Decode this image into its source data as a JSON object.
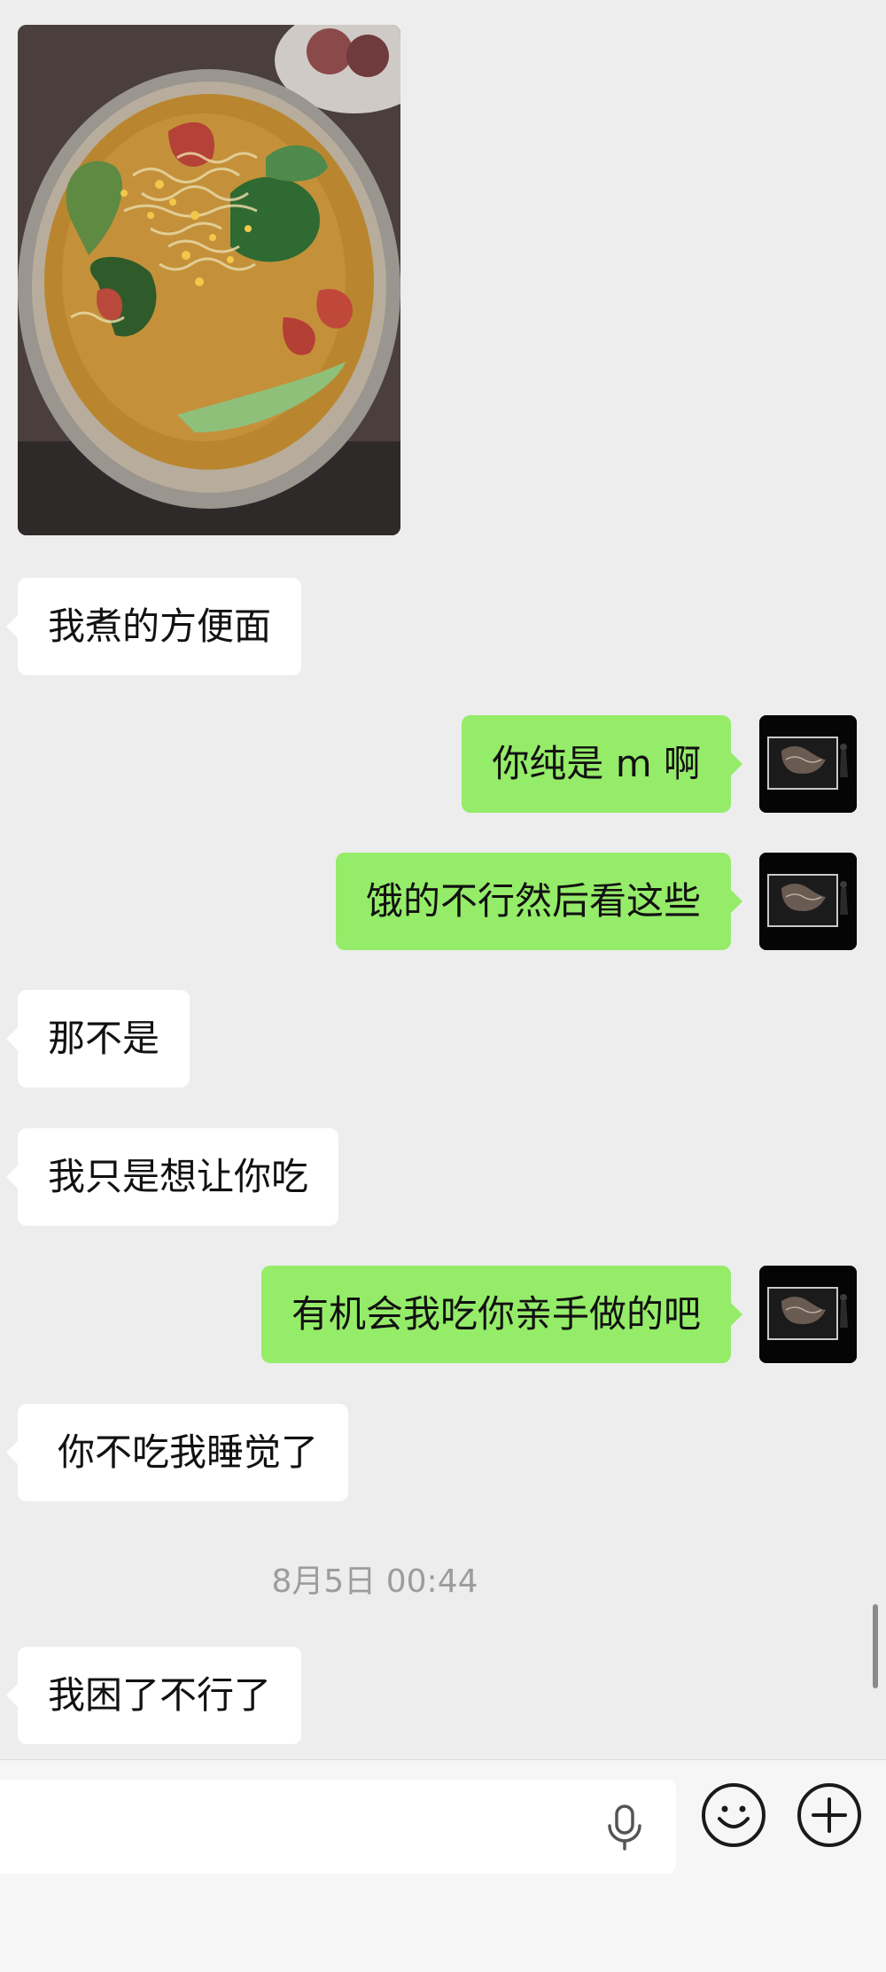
{
  "messages": [
    {
      "side": "in",
      "type": "image",
      "icon": "food-photo"
    },
    {
      "side": "in",
      "text": "我煮的方便面"
    },
    {
      "side": "out",
      "text": "你纯是 m 啊"
    },
    {
      "side": "out",
      "text": "饿的不行然后看这些"
    },
    {
      "side": "in",
      "text": "那不是"
    },
    {
      "side": "in",
      "text": "我只是想让你吃"
    },
    {
      "side": "out",
      "text": "有机会我吃你亲手做的吧"
    },
    {
      "side": "in",
      "text": "你不吃我睡觉了"
    },
    {
      "side": "in",
      "text": "我困了不行了"
    }
  ],
  "timestamp": "8月5日 00:44",
  "input": {
    "placeholder": "",
    "value": ""
  },
  "icons": {
    "mic": "microphone-icon",
    "emoji": "emoji-smile-icon",
    "plus": "plus-icon"
  },
  "colors": {
    "background": "#ededed",
    "incoming_bubble": "#ffffff",
    "outgoing_bubble": "#95ec69",
    "timestamp_text": "#9c9c9c"
  }
}
